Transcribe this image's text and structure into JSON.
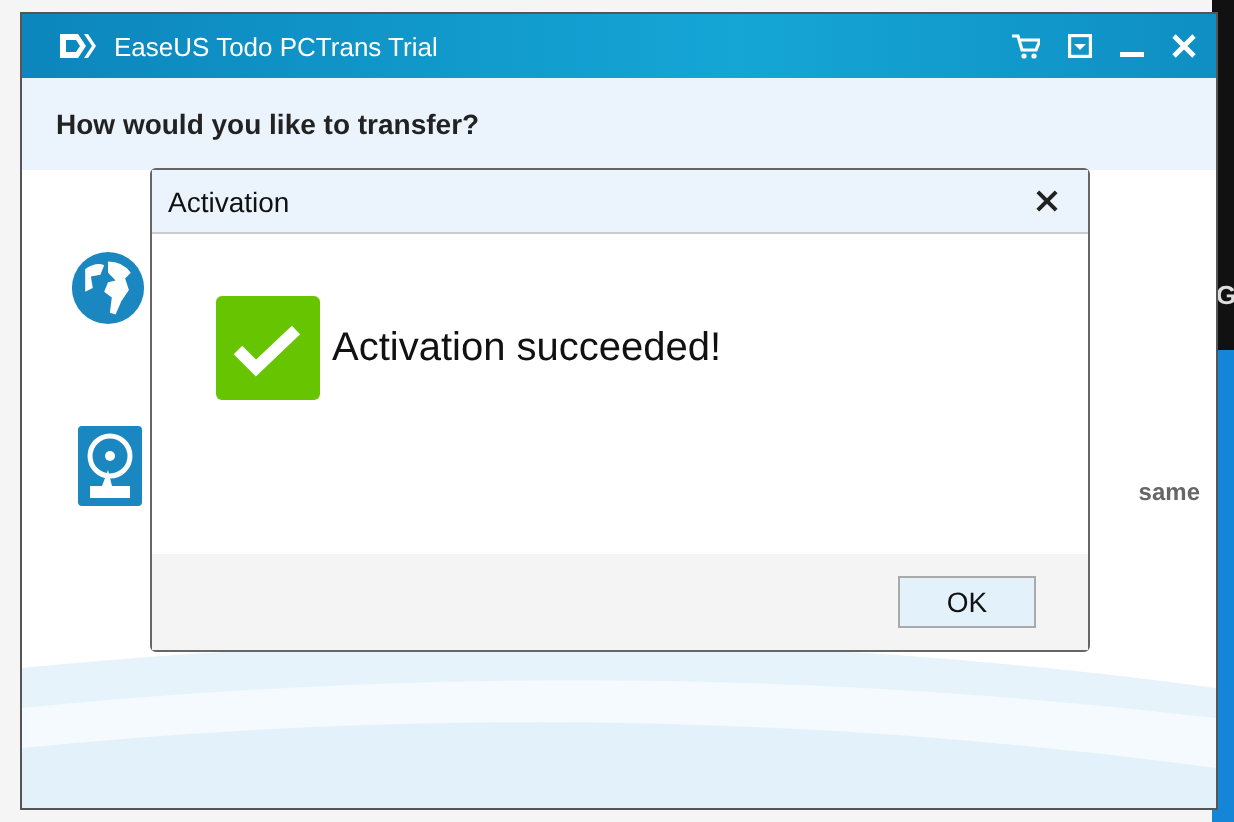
{
  "window": {
    "title": "EaseUS Todo PCTrans Trial"
  },
  "heading": "How would you like to transfer?",
  "options": [
    {
      "kind": "globe"
    },
    {
      "kind": "disk",
      "text": "same"
    }
  ],
  "desktop": {
    "text": "G"
  },
  "dialog": {
    "title": "Activation",
    "message": "Activation succeeded!",
    "buttons": [
      "OK"
    ]
  }
}
